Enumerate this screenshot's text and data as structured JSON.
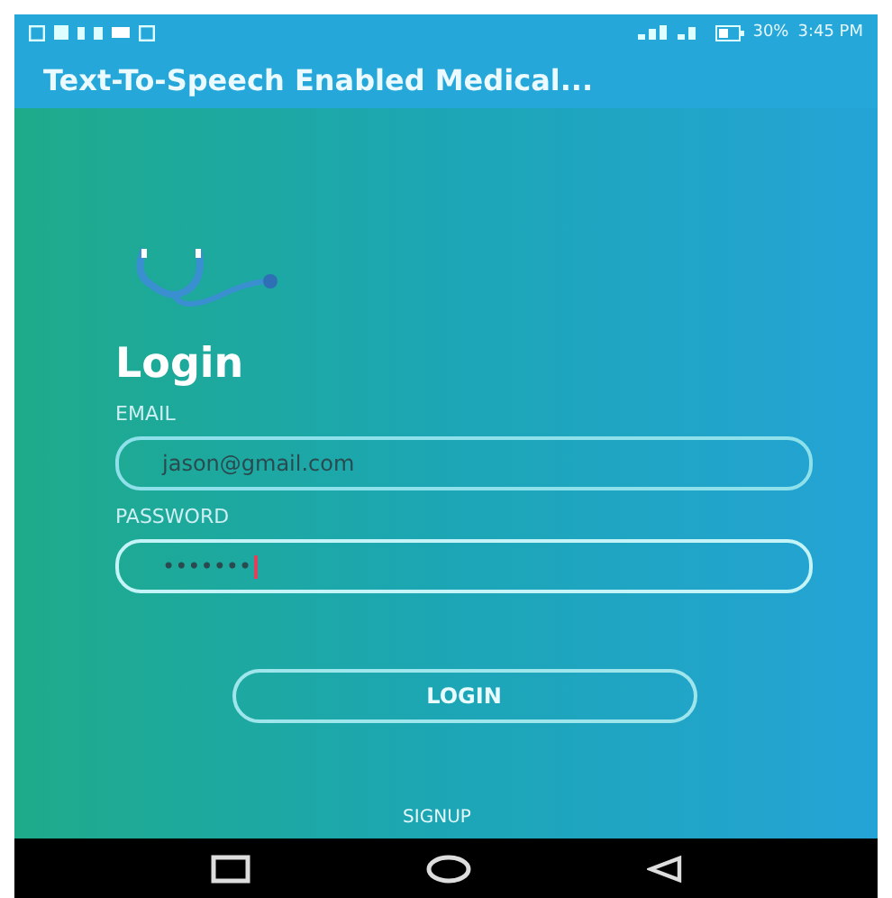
{
  "status_bar": {
    "battery": "30%",
    "time": "3:45 PM"
  },
  "app_bar": {
    "title": "Text-To-Speech Enabled Medical..."
  },
  "login": {
    "heading": "Login",
    "fields": [
      {
        "label": "EMAIL",
        "value": "jason@gmail.com",
        "focused": false
      },
      {
        "label": "PASSWORD",
        "value": "•••••••",
        "focused": true
      }
    ],
    "button": "LOGIN",
    "link": "SIGNUP"
  }
}
